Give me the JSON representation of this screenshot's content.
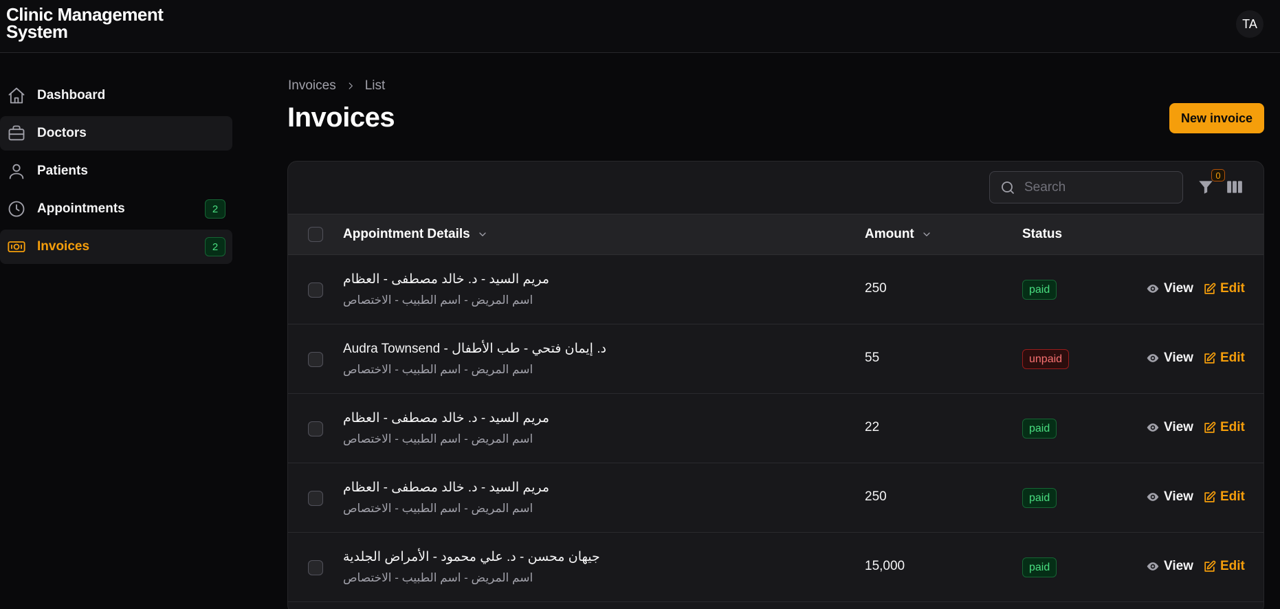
{
  "app": {
    "title": "Clinic Management System",
    "user_initials": "TA"
  },
  "sidebar": {
    "items": [
      {
        "label": "Dashboard",
        "icon": "home-icon"
      },
      {
        "label": "Doctors",
        "icon": "briefcase-icon"
      },
      {
        "label": "Patients",
        "icon": "user-icon"
      },
      {
        "label": "Appointments",
        "icon": "clock-icon",
        "badge": "2"
      },
      {
        "label": "Invoices",
        "icon": "banknote-icon",
        "badge": "2",
        "active": true
      }
    ]
  },
  "breadcrumb": {
    "root": "Invoices",
    "current": "List"
  },
  "page": {
    "title": "Invoices",
    "new_button": "New invoice"
  },
  "table": {
    "search_placeholder": "Search",
    "filter_count": "0",
    "columns": {
      "details": "Appointment Details",
      "amount": "Amount",
      "status": "Status"
    },
    "actions": {
      "view": "View",
      "edit": "Edit"
    },
    "rows": [
      {
        "title": "مريم السيد - د. خالد مصطفى - العظام",
        "subtitle": "اسم المريض - اسم الطبيب - الاختصاص",
        "amount": "250",
        "status": "paid"
      },
      {
        "title": "Audra Townsend - د. إيمان فتحي - طب الأطفال",
        "subtitle": "اسم المريض - اسم الطبيب - الاختصاص",
        "amount": "55",
        "status": "unpaid"
      },
      {
        "title": "مريم السيد - د. خالد مصطفى - العظام",
        "subtitle": "اسم المريض - اسم الطبيب - الاختصاص",
        "amount": "22",
        "status": "paid"
      },
      {
        "title": "مريم السيد - د. خالد مصطفى - العظام",
        "subtitle": "اسم المريض - اسم الطبيب - الاختصاص",
        "amount": "250",
        "status": "paid"
      },
      {
        "title": "جيهان محسن - د. علي محمود - الأمراض الجلدية",
        "subtitle": "اسم المريض - اسم الطبيب - الاختصاص",
        "amount": "15,000",
        "status": "paid"
      }
    ]
  },
  "colors": {
    "accent": "#f59e0b",
    "background": "#09090b",
    "card": "#18181b",
    "paid": "#4ade80",
    "unpaid": "#f87171"
  }
}
